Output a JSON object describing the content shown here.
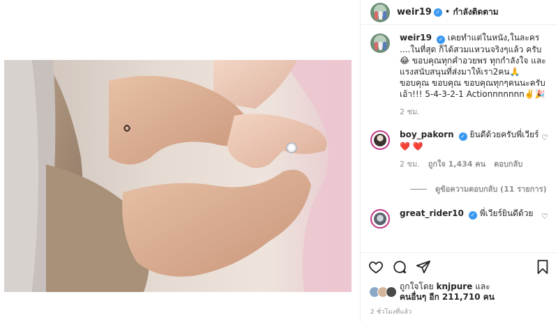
{
  "post": {
    "author": "weir19",
    "follow_status": "กำลังติดตาม",
    "separator": "•",
    "verified_mark": "✓"
  },
  "caption": {
    "username": "weir19",
    "text": "เคยทำแต่ในหนัง,ในละคร ....ในที่สุด ก็ได้สวมแหวนจริงๆแล้ว ครับ😂 ขอบคุณทุกคำอวยพร ทุกกำลังใจ และแรงสนับสนุนที่ส่งมาให้เรา2คน🙏 ขอบคุณ ขอบคุณ ขอบคุณทุกๆคนนะครับ เอ้า!!! 5-4-3-2-1 Actionnnnnnn✌️🎉",
    "time": "2 ชม."
  },
  "comments": [
    {
      "username": "boy_pakorn",
      "text": "ยินดีด้วยครับพี่เวียร์",
      "hearts": "❤️ ❤️",
      "time": "2 ชม.",
      "likes": "ถูกใจ 1,434 คน",
      "reply": "ตอบกลับ",
      "replies_link": "ดูข้อความตอบกลับ (11 รายการ)"
    },
    {
      "username": "great_rider10",
      "text": "พี่เวียร์ยินดีด้วย"
    }
  ],
  "likes": {
    "prefix": "ถูกใจโดย",
    "user": "knjpure",
    "conj": "และ",
    "others": "คนอื่นๆ อีก 211,710 คน"
  },
  "timestamp": "2 ชั่วโมงที่แล้ว",
  "icons": {
    "like": "heart-icon",
    "comment": "comment-icon",
    "share": "share-icon",
    "save": "bookmark-icon"
  },
  "colors": {
    "verified": "#3897f0",
    "muted": "#8e8e8e",
    "heart": "#ed4956"
  }
}
